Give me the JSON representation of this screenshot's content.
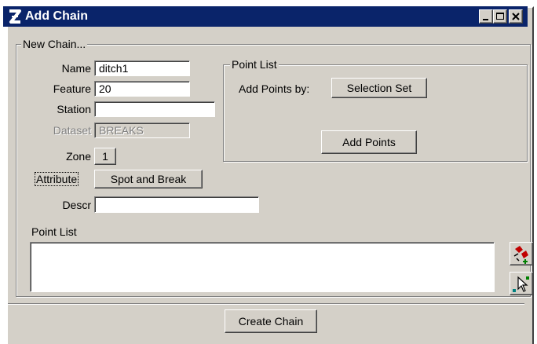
{
  "window": {
    "title": "Add Chain",
    "icon": "geopak-logo-icon"
  },
  "new_chain": {
    "legend": "New Chain...",
    "name_label": "Name",
    "name_value": "ditch1",
    "feature_label": "Feature",
    "feature_value": "20",
    "station_label": "Station",
    "station_value": "",
    "dataset_label": "Dataset",
    "dataset_value": "BREAKS",
    "zone_label": "Zone",
    "zone_value": "1",
    "attribute_label": "Attribute",
    "attribute_value": "Spot and Break",
    "descr_label": "Descr",
    "descr_value": "",
    "point_list_label": "Point List"
  },
  "point_list_group": {
    "legend": "Point List",
    "add_points_by_label": "Add Points by:",
    "add_points_by_value": "Selection Set",
    "add_points_button": "Add Points"
  },
  "side_icons": [
    "add-points-icon",
    "select-pointer-icon"
  ],
  "footer": {
    "create_chain_button": "Create Chain"
  },
  "colors": {
    "titlebar": "#0a246a",
    "dialog_face": "#d4d0c8",
    "field_background": "#ffffff"
  }
}
